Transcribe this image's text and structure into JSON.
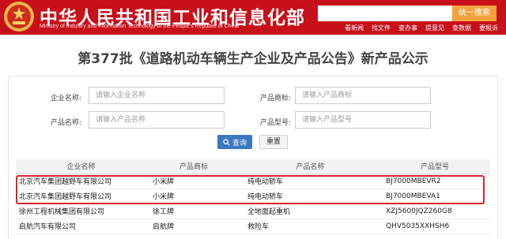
{
  "header": {
    "title": "中华人民共和国工业和信息化部",
    "subtitle": "Ministry of Industry and Information Technology of the People's Republic of China",
    "search_button": "统一搜索",
    "nav": [
      "看新闻",
      "找文件",
      "查办事",
      "提意见",
      "查数据",
      "要报诉"
    ],
    "colors": {
      "header_bg": "#c8101a",
      "search_button_bg": "#f4a23c"
    }
  },
  "page": {
    "title": "第377批《道路机动车辆生产企业及产品公告》新产品公示"
  },
  "form": {
    "company_label": "企业名称:",
    "company_placeholder": "请输入企业名称",
    "trademark_label": "产品商标:",
    "trademark_placeholder": "请输入产品商标",
    "product_name_label": "产品名称:",
    "product_name_placeholder": "请输入产品名称",
    "model_label": "产品型号:",
    "model_placeholder": "请输入产品型号",
    "search_label": "查询",
    "reset_label": "重置"
  },
  "table": {
    "headers": [
      "企业名称",
      "产品商标",
      "产品名称",
      "产品型号"
    ],
    "rows": [
      [
        "北京汽车集团越野车有限公司",
        "小米牌",
        "纯电动轿车",
        "BJ7000MBEVR2"
      ],
      [
        "北京汽车集团越野车有限公司",
        "小米牌",
        "纯电动轿车",
        "BJ7000MBEVA1"
      ],
      [
        "徐州工程机械集团有限公司",
        "徐工牌",
        "全地面起重机",
        "XZJ5600JQZ260G8"
      ],
      [
        "启航汽车有限公司",
        "启航牌",
        "救险车",
        "QHV5035XXHSH6"
      ]
    ],
    "highlight_color": "#d9262b"
  }
}
